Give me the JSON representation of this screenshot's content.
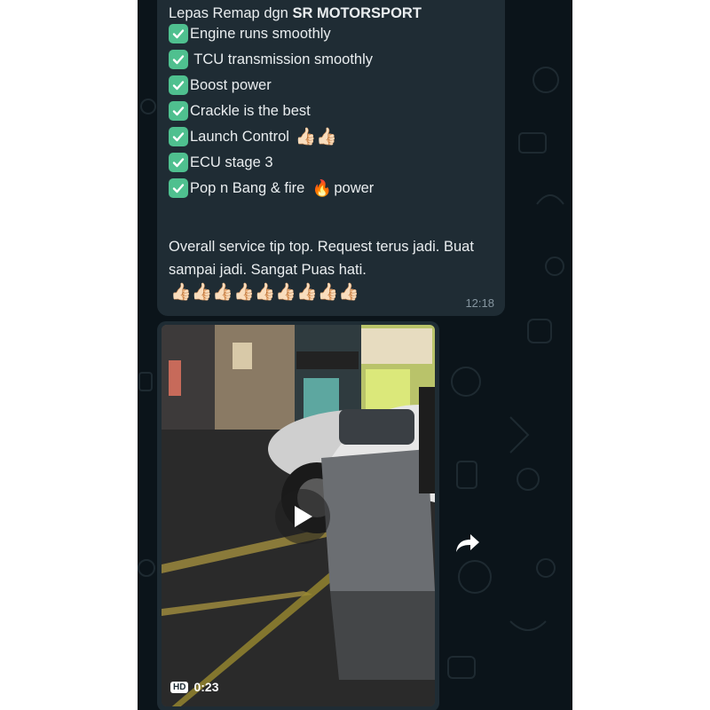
{
  "message": {
    "title_prefix": "Lepas Remap dgn ",
    "title_brand": "SR MOTORSPORT",
    "items": [
      {
        "text": "Engine runs smoothly",
        "suffix": ""
      },
      {
        "text": " TCU transmission smoothly",
        "suffix": ""
      },
      {
        "text": "Boost power",
        "suffix": ""
      },
      {
        "text": "Crackle is the best",
        "suffix": ""
      },
      {
        "text": "Launch Control ",
        "suffix": "👍🏻👍🏻"
      },
      {
        "text": "ECU stage 3",
        "suffix": ""
      },
      {
        "text": "Pop n Bang & fire ",
        "suffix": "power"
      }
    ],
    "paragraph": "Overall service tip top. Request terus jadi. Buat sampai jadi. Sangat Puas hati.",
    "paragraph_emoji": "👍🏻👍🏻👍🏻👍🏻👍🏻👍🏻👍🏻👍🏻👍🏻",
    "fire_emoji": "🔥",
    "time": "12:18"
  },
  "video": {
    "quality_badge": "HD",
    "duration": "0:23"
  },
  "icons": {
    "check": "check-mark-button-icon",
    "play": "play-icon",
    "forward": "forward-icon"
  },
  "colors": {
    "chat_background": "#0b141a",
    "bubble": "#1f2c34",
    "text": "#e9edef",
    "timestamp": "#8696a0",
    "check_green": "#4fc08f"
  }
}
